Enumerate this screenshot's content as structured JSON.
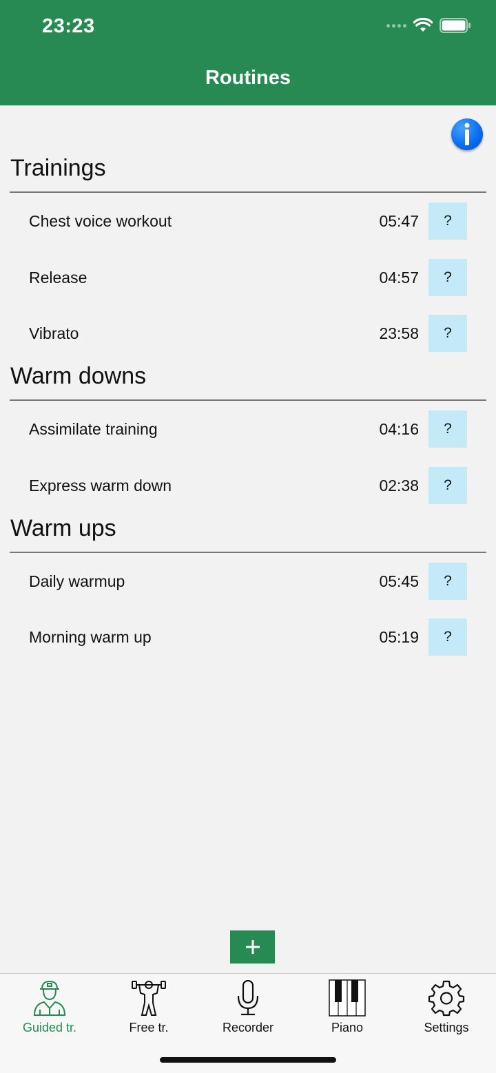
{
  "status": {
    "time": "23:23"
  },
  "header": {
    "title": "Routines"
  },
  "sections": [
    {
      "title": "Trainings",
      "items": [
        {
          "name": "Chest voice workout",
          "duration": "05:47",
          "help": "?"
        },
        {
          "name": "Release",
          "duration": "04:57",
          "help": "?"
        },
        {
          "name": "Vibrato",
          "duration": "23:58",
          "help": "?"
        }
      ]
    },
    {
      "title": "Warm downs",
      "items": [
        {
          "name": "Assimilate training",
          "duration": "04:16",
          "help": "?"
        },
        {
          "name": "Express warm down",
          "duration": "02:38",
          "help": "?"
        }
      ]
    },
    {
      "title": "Warm ups",
      "items": [
        {
          "name": "Daily warmup",
          "duration": "05:45",
          "help": "?"
        },
        {
          "name": "Morning warm up",
          "duration": "05:19",
          "help": "?"
        }
      ]
    }
  ],
  "tabs": [
    {
      "label": "Guided tr.",
      "icon": "trainer-icon",
      "active": true
    },
    {
      "label": "Free tr.",
      "icon": "dumbbell-person-icon",
      "active": false
    },
    {
      "label": "Recorder",
      "icon": "microphone-icon",
      "active": false
    },
    {
      "label": "Piano",
      "icon": "piano-keys-icon",
      "active": false
    },
    {
      "label": "Settings",
      "icon": "gear-icon",
      "active": false
    }
  ],
  "colors": {
    "accent": "#268a52",
    "help_bg": "#c4eaf7",
    "info_blue": "#0a6ff0"
  }
}
